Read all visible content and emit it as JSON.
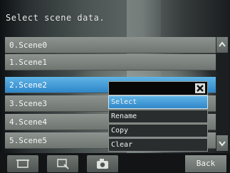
{
  "header": {
    "title": "Select scene data."
  },
  "scene_list": {
    "items": [
      {
        "label": "0.Scene0",
        "selected": false
      },
      {
        "label": "1.Scene1",
        "selected": false
      },
      {
        "label": "2.Scene2",
        "selected": true
      },
      {
        "label": "3.Scene3",
        "selected": false
      },
      {
        "label": "4.Scene4",
        "selected": false
      },
      {
        "label": "5.Scene5",
        "selected": false
      }
    ]
  },
  "scrollbar": {
    "up_icon": "chevron-up-icon",
    "down_icon": "chevron-down-icon"
  },
  "context_menu": {
    "close_icon": "close-icon",
    "items": [
      {
        "label": "Select",
        "active": true
      },
      {
        "label": "Rename",
        "active": false
      },
      {
        "label": "Copy",
        "active": false
      },
      {
        "label": "Clear",
        "active": false
      }
    ]
  },
  "toolbar": {
    "buttons": [
      {
        "icon": "display-frame-icon"
      },
      {
        "icon": "zoom-view-icon"
      },
      {
        "icon": "camera-icon"
      }
    ],
    "back_label": "Back"
  },
  "colors": {
    "selection": "#3a9ad8",
    "row": "#7d8480",
    "background": "#1a1d1f"
  }
}
